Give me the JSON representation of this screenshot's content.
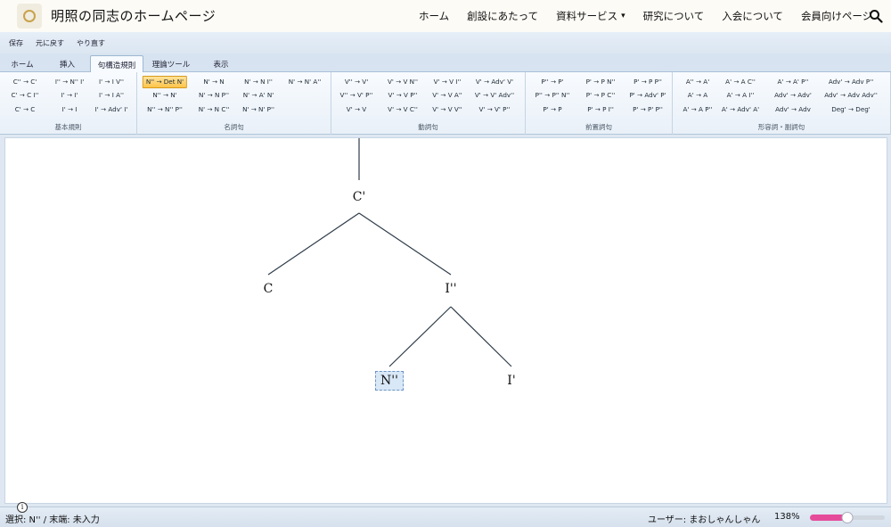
{
  "site": {
    "title": "明照の同志のホームページ",
    "nav": [
      {
        "label": "ホーム",
        "has_menu": false
      },
      {
        "label": "創設にあたって",
        "has_menu": false
      },
      {
        "label": "資料サービス",
        "has_menu": true
      },
      {
        "label": "研究について",
        "has_menu": false
      },
      {
        "label": "入会について",
        "has_menu": false
      },
      {
        "label": "会員向けページ",
        "has_menu": false
      }
    ],
    "search_icon": "search-icon"
  },
  "quickbar": {
    "save": "保存",
    "undo": "元に戻す",
    "redo": "やり直す"
  },
  "tabs": [
    {
      "label": "ホーム",
      "active": false
    },
    {
      "label": "挿入",
      "active": false
    },
    {
      "label": "句構造規則",
      "active": true
    },
    {
      "label": "理論ツール",
      "active": false
    },
    {
      "label": "表示",
      "active": false
    }
  ],
  "ribbon": {
    "groups": [
      {
        "label": "基本規則",
        "rules": [
          [
            "C'' → C'",
            "I'' → N'' I'",
            "I' → I V''"
          ],
          [
            "C' → C I''",
            "I' → I'",
            "I' → I A''"
          ],
          [
            "C' → C",
            "I' → I",
            "I' → Adv' I'"
          ]
        ]
      },
      {
        "label": "名詞句",
        "rules": [
          [
            "N'' → Det N'",
            "N' → N",
            "N' → N I''",
            "N' → N' A''"
          ],
          [
            "N'' → N'",
            "N' → N P''",
            "N' → A' N'"
          ],
          [
            "N'' → N'' P''",
            "N' → N C''",
            "N' → N' P''"
          ]
        ]
      },
      {
        "label": "動詞句",
        "rules": [
          [
            "V'' → V'",
            "V' → V N''",
            "V' → V I''",
            "V' → Adv' V'"
          ],
          [
            "V'' → V' P''",
            "V' → V P''",
            "V' → V A''",
            "V' → V' Adv''"
          ],
          [
            "V' → V",
            "V' → V C''",
            "V' → V V''",
            "V' → V' P''"
          ]
        ]
      },
      {
        "label": "前置詞句",
        "rules": [
          [
            "P'' → P'",
            "P' → P N''",
            "P' → P P''"
          ],
          [
            "P'' → P'' N''",
            "P' → P C''",
            "P' → Adv' P'"
          ],
          [
            "P' → P",
            "P' → P I''",
            "P' → P' P''"
          ]
        ]
      },
      {
        "label": "形容詞・副詞句",
        "rules": [
          [
            "A'' → A'",
            "A' → A C''",
            "A' → A' P''",
            "Adv' → Adv P''"
          ],
          [
            "A' → A",
            "A' → A I''",
            "Adv' → Adv'",
            "Adv' → Adv Adv''"
          ],
          [
            "A' → A P''",
            "A' → Adv' A'",
            "Adv' → Adv",
            "Deg' → Deg'"
          ]
        ]
      }
    ],
    "selected_rule": "N'' → Det N'"
  },
  "tree": {
    "nodes": [
      {
        "id": "c-bar",
        "label": "C'",
        "selected": false
      },
      {
        "id": "c",
        "label": "C",
        "selected": false
      },
      {
        "id": "i-double-bar",
        "label": "I''",
        "selected": false
      },
      {
        "id": "n-double-bar",
        "label": "N''",
        "selected": true
      },
      {
        "id": "i-bar",
        "label": "I'",
        "selected": false
      }
    ]
  },
  "status": {
    "selection": "選択: N'' / 末端: 未入力",
    "user": "ユーザー: まおしゃんしゃん",
    "zoom_label": "138%",
    "zoom_fraction": 0.5
  },
  "colors": {
    "accent": "#e64b9a",
    "selection": "#ffc44a",
    "tree_line": "#2f3d4a"
  }
}
